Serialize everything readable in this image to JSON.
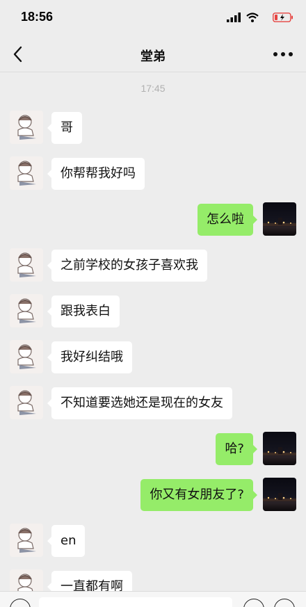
{
  "status_bar": {
    "time": "18:56"
  },
  "nav": {
    "title": "堂弟",
    "back_icon": "chevron-left-icon",
    "more_icon": "more-dots-icon"
  },
  "chat": {
    "timestamp": "17:45",
    "messages": [
      {
        "side": "left",
        "text": "哥"
      },
      {
        "side": "left",
        "text": "你帮帮我好吗"
      },
      {
        "side": "right",
        "text": "怎么啦"
      },
      {
        "side": "left",
        "text": "之前学校的女孩子喜欢我"
      },
      {
        "side": "left",
        "text": "跟我表白"
      },
      {
        "side": "left",
        "text": "我好纠结哦"
      },
      {
        "side": "left",
        "text": "不知道要选她还是现在的女友"
      },
      {
        "side": "right",
        "text": "哈?"
      },
      {
        "side": "right",
        "text": "你又有女朋友了?"
      },
      {
        "side": "left",
        "text": "en"
      },
      {
        "side": "left",
        "text": "一直都有啊"
      }
    ]
  },
  "colors": {
    "background": "#ededed",
    "outgoing_bubble": "#95ec69",
    "incoming_bubble": "#ffffff",
    "battery_low": "#e64340"
  }
}
